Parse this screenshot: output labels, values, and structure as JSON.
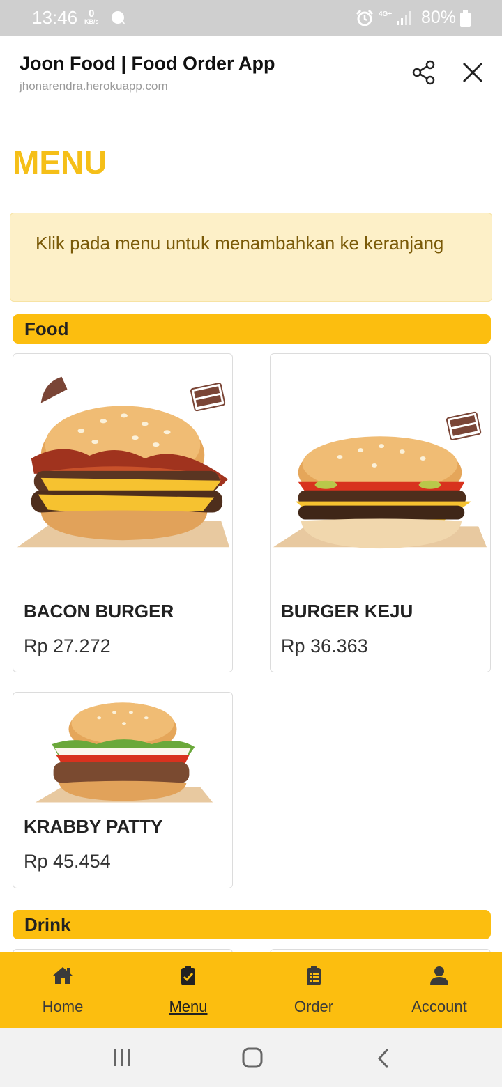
{
  "status_bar": {
    "time": "13:46",
    "net_speed_value": "0",
    "net_speed_unit": "KB/s",
    "network": "4G+",
    "battery": "80%",
    "icons": [
      "chat-bubble-icon",
      "alarm-icon",
      "signal-icon",
      "battery-icon"
    ]
  },
  "browser": {
    "title": "Joon Food | Food Order App",
    "url": "jhonarendra.herokuapp.com",
    "icons": [
      "share-icon",
      "close-icon"
    ]
  },
  "page": {
    "title": "MENU",
    "info": "Klik pada menu untuk menambahkan ke keranjang"
  },
  "sections": {
    "food": {
      "label": "Food",
      "items": [
        {
          "name": "BACON BURGER",
          "price": "Rp 27.272"
        },
        {
          "name": "BURGER KEJU",
          "price": "Rp 36.363"
        },
        {
          "name": "KRABBY PATTY",
          "price": "Rp 45.454"
        }
      ]
    },
    "drink": {
      "label": "Drink"
    }
  },
  "bottom_nav": {
    "items": [
      {
        "label": "Home",
        "icon": "home-icon"
      },
      {
        "label": "Menu",
        "icon": "clipboard-check-icon",
        "active": true
      },
      {
        "label": "Order",
        "icon": "clipboard-list-icon"
      },
      {
        "label": "Account",
        "icon": "user-icon"
      }
    ]
  },
  "colors": {
    "accent": "#fcbe0f",
    "title": "#f5bf18",
    "info_bg": "#fdf0c8",
    "info_text": "#7a5a08"
  }
}
